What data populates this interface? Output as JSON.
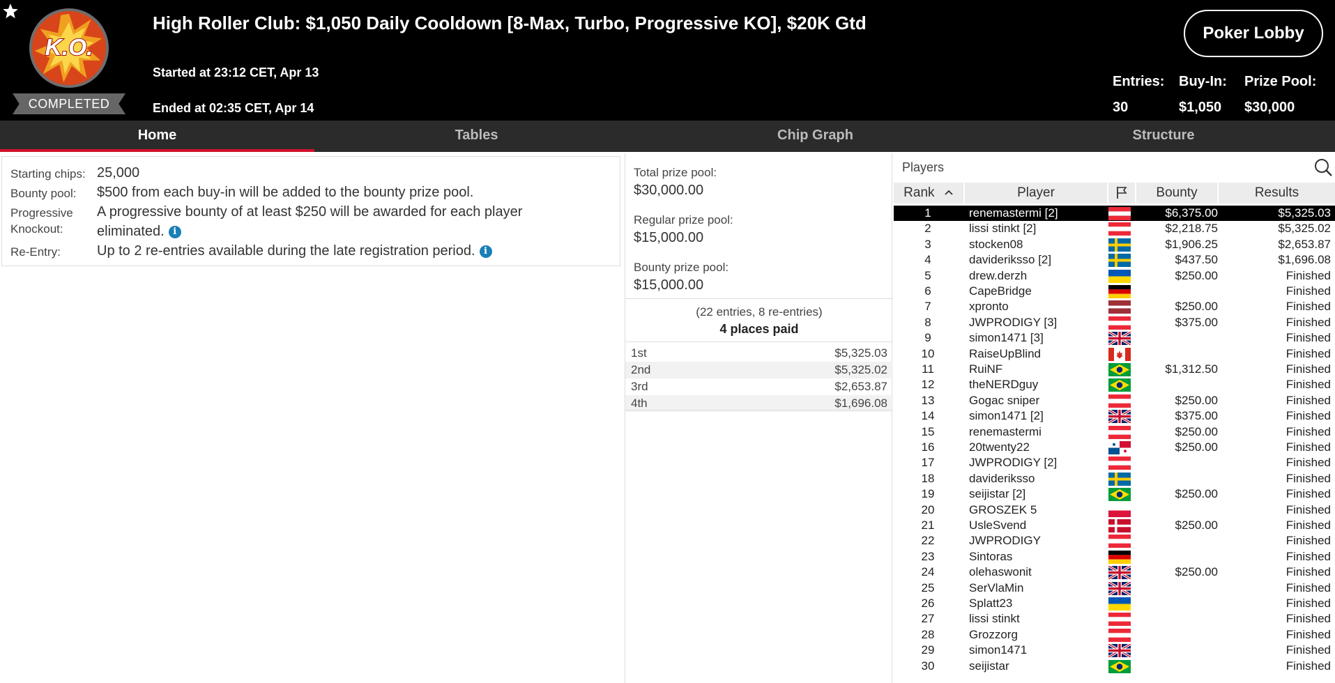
{
  "header": {
    "title": "High Roller Club: $1,050 Daily Cooldown [8-Max, Turbo, Progressive KO], $20K Gtd",
    "started": "Started at 23:12 CET, Apr 13",
    "ended": "Ended at 02:35 CET, Apr 14",
    "status": "COMPLETED",
    "logo_text": "K.O.",
    "lobby_button": "Poker Lobby",
    "stats": {
      "entries_label": "Entries:",
      "entries_value": "30",
      "buyin_label": "Buy-In:",
      "buyin_value": "$1,050",
      "prizepool_label": "Prize Pool:",
      "prizepool_value": "$30,000"
    }
  },
  "tabs": [
    {
      "label": "Home",
      "active": true
    },
    {
      "label": "Tables",
      "active": false
    },
    {
      "label": "Chip Graph",
      "active": false
    },
    {
      "label": "Structure",
      "active": false
    }
  ],
  "info": {
    "starting_chips_label": "Starting chips:",
    "starting_chips_value": "25,000",
    "bounty_pool_label": "Bounty pool:",
    "bounty_pool_value": "$500 from each buy-in will be added to the bounty prize pool.",
    "progressive_label_1": "Progressive",
    "progressive_label_2": "Knockout:",
    "progressive_value_1": "A progressive bounty of at least $250 will be awarded for each player",
    "progressive_value_2": "eliminated.",
    "reentry_label": "Re-Entry:",
    "reentry_value": "Up to 2 re-entries available during the late registration period."
  },
  "prize": {
    "total_label": "Total prize pool:",
    "total_value": "$30,000.00",
    "regular_label": "Regular prize pool:",
    "regular_value": "$15,000.00",
    "bounty_label": "Bounty prize pool:",
    "bounty_value": "$15,000.00",
    "entries_note": "(22 entries, 8 re-entries)",
    "places_paid": "4 places paid",
    "payouts": [
      {
        "place": "1st",
        "amount": "$5,325.03"
      },
      {
        "place": "2nd",
        "amount": "$5,325.02"
      },
      {
        "place": "3rd",
        "amount": "$2,653.87"
      },
      {
        "place": "4th",
        "amount": "$1,696.08"
      }
    ]
  },
  "players": {
    "title": "Players",
    "columns": {
      "rank": "Rank",
      "player": "Player",
      "bounty": "Bounty",
      "results": "Results"
    },
    "colors": {
      "selected_row": "#000000",
      "accent": "#d0112b"
    },
    "rows": [
      {
        "rank": "1",
        "name": "renemastermi [2]",
        "flag": "austria",
        "bounty": "$6,375.00",
        "result": "$5,325.03"
      },
      {
        "rank": "2",
        "name": "lissi stinkt [2]",
        "flag": "austria",
        "bounty": "$2,218.75",
        "result": "$5,325.02"
      },
      {
        "rank": "3",
        "name": "stocken08",
        "flag": "sweden",
        "bounty": "$1,906.25",
        "result": "$2,653.87"
      },
      {
        "rank": "4",
        "name": "davideriksso [2]",
        "flag": "sweden",
        "bounty": "$437.50",
        "result": "$1,696.08"
      },
      {
        "rank": "5",
        "name": "drew.derzh",
        "flag": "ukraine",
        "bounty": "$250.00",
        "result": "Finished"
      },
      {
        "rank": "6",
        "name": "CapeBridge",
        "flag": "germany",
        "bounty": "",
        "result": "Finished"
      },
      {
        "rank": "7",
        "name": "xpronto",
        "flag": "latvia",
        "bounty": "$250.00",
        "result": "Finished"
      },
      {
        "rank": "8",
        "name": "JWPRODIGY [3]",
        "flag": "austria",
        "bounty": "$375.00",
        "result": "Finished"
      },
      {
        "rank": "9",
        "name": "simon1471 [3]",
        "flag": "uk",
        "bounty": "",
        "result": "Finished"
      },
      {
        "rank": "10",
        "name": "RaiseUpBlind",
        "flag": "canada",
        "bounty": "",
        "result": "Finished"
      },
      {
        "rank": "11",
        "name": "RuiNF",
        "flag": "brazil",
        "bounty": "$1,312.50",
        "result": "Finished"
      },
      {
        "rank": "12",
        "name": "theNERDguy",
        "flag": "brazil",
        "bounty": "",
        "result": "Finished"
      },
      {
        "rank": "13",
        "name": "Gogac sniper",
        "flag": "austria",
        "bounty": "$250.00",
        "result": "Finished"
      },
      {
        "rank": "14",
        "name": "simon1471 [2]",
        "flag": "uk",
        "bounty": "$375.00",
        "result": "Finished"
      },
      {
        "rank": "15",
        "name": "renemastermi",
        "flag": "austria",
        "bounty": "$250.00",
        "result": "Finished"
      },
      {
        "rank": "16",
        "name": "20twenty22",
        "flag": "panama",
        "bounty": "$250.00",
        "result": "Finished"
      },
      {
        "rank": "17",
        "name": "JWPRODIGY [2]",
        "flag": "austria",
        "bounty": "",
        "result": "Finished"
      },
      {
        "rank": "18",
        "name": "davideriksso",
        "flag": "sweden",
        "bounty": "",
        "result": "Finished"
      },
      {
        "rank": "19",
        "name": "seijistar [2]",
        "flag": "brazil",
        "bounty": "$250.00",
        "result": "Finished"
      },
      {
        "rank": "20",
        "name": "GROSZEK 5",
        "flag": "poland",
        "bounty": "",
        "result": "Finished"
      },
      {
        "rank": "21",
        "name": "UsleSvend",
        "flag": "denmark",
        "bounty": "$250.00",
        "result": "Finished"
      },
      {
        "rank": "22",
        "name": "JWPRODIGY",
        "flag": "austria",
        "bounty": "",
        "result": "Finished"
      },
      {
        "rank": "23",
        "name": "Sintoras",
        "flag": "germany",
        "bounty": "",
        "result": "Finished"
      },
      {
        "rank": "24",
        "name": "olehaswonit",
        "flag": "uk",
        "bounty": "$250.00",
        "result": "Finished"
      },
      {
        "rank": "25",
        "name": "SerVlaMin",
        "flag": "uk",
        "bounty": "",
        "result": "Finished"
      },
      {
        "rank": "26",
        "name": "Splatt23",
        "flag": "ukraine",
        "bounty": "",
        "result": "Finished"
      },
      {
        "rank": "27",
        "name": "lissi stinkt",
        "flag": "austria",
        "bounty": "",
        "result": "Finished"
      },
      {
        "rank": "28",
        "name": "Grozzorg",
        "flag": "austria",
        "bounty": "",
        "result": "Finished"
      },
      {
        "rank": "29",
        "name": "simon1471",
        "flag": "uk",
        "bounty": "",
        "result": "Finished"
      },
      {
        "rank": "30",
        "name": "seijistar",
        "flag": "brazil",
        "bounty": "",
        "result": "Finished"
      }
    ]
  }
}
